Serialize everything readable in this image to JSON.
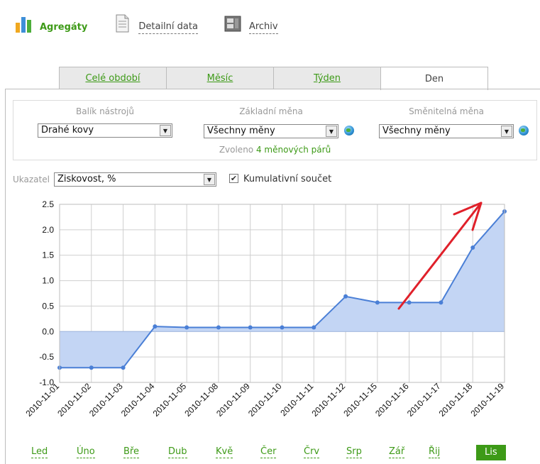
{
  "topnav": [
    {
      "label": "Agregáty",
      "icon": "bar-chart-icon",
      "active": true
    },
    {
      "label": "Detailní data",
      "icon": "document-icon",
      "active": false
    },
    {
      "label": "Archiv",
      "icon": "archive-icon",
      "active": false
    }
  ],
  "tabs": [
    {
      "label": "Celé období",
      "active": false
    },
    {
      "label": "Měsíc",
      "active": false
    },
    {
      "label": "Týden",
      "active": false
    },
    {
      "label": "Den",
      "active": true
    }
  ],
  "filters": {
    "toolkit_label": "Balík nástrojů",
    "toolkit_value": "Drahé kovy",
    "base_currency_label": "Základní měna",
    "base_currency_value": "Všechny měny",
    "quote_currency_label": "Směnitelná měna",
    "quote_currency_value": "Všechny měny",
    "selected_prefix": "Zvoleno",
    "selected_count_text": "4 měnových párů"
  },
  "indicator": {
    "label": "Ukazatel",
    "value": "Ziskovost, %",
    "cumulative_label": "Kumulativní součet",
    "cumulative_checked": true
  },
  "chart_data": {
    "type": "area",
    "title": "",
    "xlabel": "",
    "ylabel": "",
    "x": [
      "2010-11-01",
      "2010-11-02",
      "2010-11-03",
      "2010-11-04",
      "2010-11-05",
      "2010-11-08",
      "2010-11-09",
      "2010-11-10",
      "2010-11-11",
      "2010-11-12",
      "2010-11-15",
      "2010-11-16",
      "2010-11-17",
      "2010-11-18",
      "2010-11-19"
    ],
    "series": [
      {
        "values": [
          -0.71,
          -0.71,
          -0.71,
          0.1,
          0.08,
          0.08,
          0.08,
          0.08,
          0.08,
          0.69,
          0.57,
          0.57,
          0.57,
          1.65,
          2.36
        ]
      }
    ],
    "ylim": [
      -1.0,
      2.5
    ],
    "yticks": [
      "2.5",
      "2.0",
      "1.5",
      "1.0",
      "0.5",
      "0.0",
      "-0.5",
      "-1.0"
    ],
    "grid": true,
    "colors": {
      "line": "#4a7fd6",
      "fill": "#c3d5f4",
      "annotation_arrow": "#e0202a"
    }
  },
  "months": [
    {
      "label": "Led",
      "active": false
    },
    {
      "label": "Úno",
      "active": false
    },
    {
      "label": "Bře",
      "active": false
    },
    {
      "label": "Dub",
      "active": false
    },
    {
      "label": "Kvě",
      "active": false
    },
    {
      "label": "Čer",
      "active": false
    },
    {
      "label": "Črv",
      "active": false
    },
    {
      "label": "Srp",
      "active": false
    },
    {
      "label": "Zář",
      "active": false
    },
    {
      "label": "Řij",
      "active": false
    },
    {
      "label": "Lis",
      "active": true
    }
  ]
}
